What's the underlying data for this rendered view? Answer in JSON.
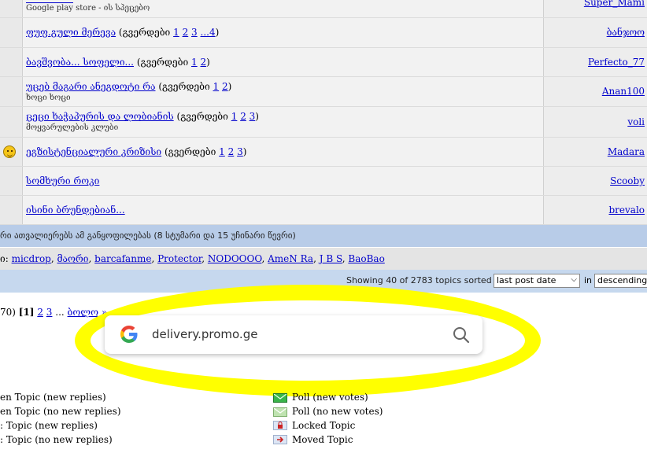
{
  "topics": [
    {
      "title": "",
      "pages_prefix": "",
      "pages": [],
      "subtitle": "Google play store - ის სპეცებო",
      "user": "Super_Mami",
      "icon": ""
    },
    {
      "title": "ფუფ.გული მერევა",
      "pages_prefix": "(გვერდები",
      "pages": [
        "1",
        "2",
        "3",
        "...4"
      ],
      "pages_suffix": ")",
      "subtitle": "",
      "user": "ბანჯოო",
      "icon": ""
    },
    {
      "title": "ბავშვობა... სოფელი...",
      "pages_prefix": "(გვერდები",
      "pages": [
        "1",
        "2"
      ],
      "pages_suffix": ")",
      "subtitle": "",
      "user": "Perfecto_77",
      "icon": ""
    },
    {
      "title": "უცებ მაგარი ანეგდოტი რა",
      "pages_prefix": "(გვერდები",
      "pages": [
        "1",
        "2"
      ],
      "pages_suffix": ")",
      "subtitle": "ხოცი ხოცი",
      "user": "Anan100",
      "icon": ""
    },
    {
      "title": "ცეცი ხაჭაპურის და ლობიანის",
      "pages_prefix": "(გვერდები",
      "pages": [
        "1",
        "2",
        "3"
      ],
      "pages_suffix": ")",
      "subtitle": "მოყვარულების კლუბი",
      "user": "voli",
      "icon": ""
    },
    {
      "title": "ეგზისტენციალური კრიზისი",
      "pages_prefix": "(გვერდები",
      "pages": [
        "1",
        "2",
        "3"
      ],
      "pages_suffix": ")",
      "subtitle": "",
      "user": "Madara",
      "icon": "smiley-icon"
    },
    {
      "title": "სომხური როკი",
      "pages_prefix": "",
      "pages": [],
      "pages_suffix": "",
      "subtitle": "",
      "user": "Scooby",
      "icon": ""
    },
    {
      "title": "ისინი ბრუნდებიან...",
      "pages_prefix": "",
      "pages": [],
      "pages_suffix": "",
      "subtitle": "",
      "user": "brevalo",
      "icon": ""
    }
  ],
  "viewers_bar": {
    "text": "რი ათვალიერებს ამ განყოფილებას (8 სტუმარი და 15 უჩინარი წევრი)"
  },
  "members_bar": {
    "prefix": "ი:",
    "members": [
      "micdrop",
      "მაორი",
      "barcafanme",
      "Protector",
      "NODOOOO",
      "AmeN Ra",
      "J B S",
      "BaoBao"
    ]
  },
  "sort_bar": {
    "showing_text": "Showing 40 of 2783 topics sorted by",
    "sort_by_value": "last post date",
    "in_label": "in",
    "order_value": "descending o"
  },
  "pagination": {
    "prefix": "70)",
    "current": "[1]",
    "pages": [
      "2",
      "3"
    ],
    "ellipsis": "...",
    "last_label": "ბოლო »"
  },
  "search_overlay": {
    "query": "delivery.promo.ge",
    "highlight_color": "#ffff00"
  },
  "legend": {
    "left": [
      "en Topic (new replies)",
      "en Topic (no new replies)",
      ": Topic (new replies)",
      ": Topic (no new replies)"
    ],
    "right": [
      {
        "label": "Poll (new votes)",
        "icon": "poll-new-icon"
      },
      {
        "label": "Poll (no new votes)",
        "icon": "poll-icon"
      },
      {
        "label": "Locked Topic",
        "icon": "lock-icon"
      },
      {
        "label": "Moved Topic",
        "icon": "moved-icon"
      }
    ]
  },
  "colors": {
    "link": "#0000cc",
    "row_bg": "#f2f2f2",
    "bar_blue": "#b8cce8",
    "google_blue": "#4285f4",
    "google_red": "#ea4335",
    "google_yellow": "#fbbc05",
    "google_green": "#34a853"
  }
}
